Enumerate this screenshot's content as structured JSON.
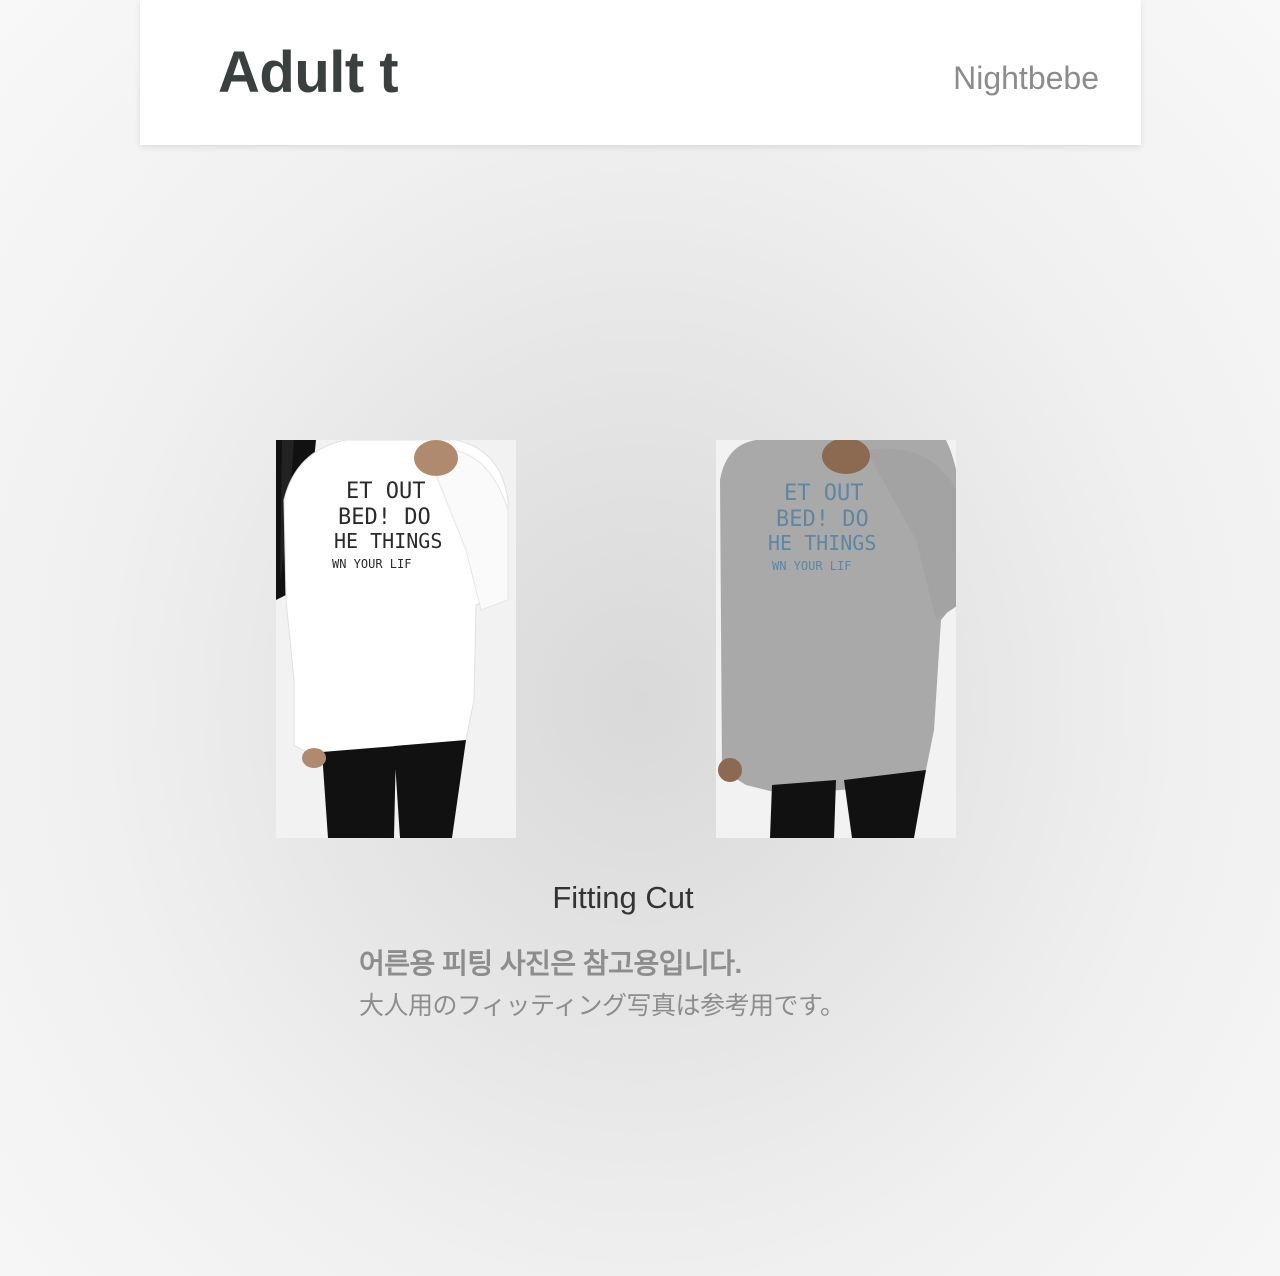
{
  "header": {
    "title": "Adult t",
    "brand": "Nightbebe"
  },
  "photos": [
    {
      "alt": "White long-sleeve t-shirt fitting photo",
      "shirt_color": "#ffffff",
      "print_color": "#2a2a2a",
      "print_lines": [
        "ET OUT",
        "BED! DO",
        "HE THINGS",
        "WN YOUR LIF"
      ]
    },
    {
      "alt": "Grey long-sleeve t-shirt fitting photo",
      "shirt_color": "#a9a9a9",
      "print_color": "#5f86a3",
      "print_lines": [
        "ET OUT",
        "BED! DO",
        "HE THINGS",
        "WN YOUR LIF"
      ]
    }
  ],
  "caption": {
    "title": "Fitting Cut",
    "note_ko": "어른용 피팅 사진은 참고용입니다.",
    "note_ja": "大人用のフィッティング写真は参考用です。"
  }
}
